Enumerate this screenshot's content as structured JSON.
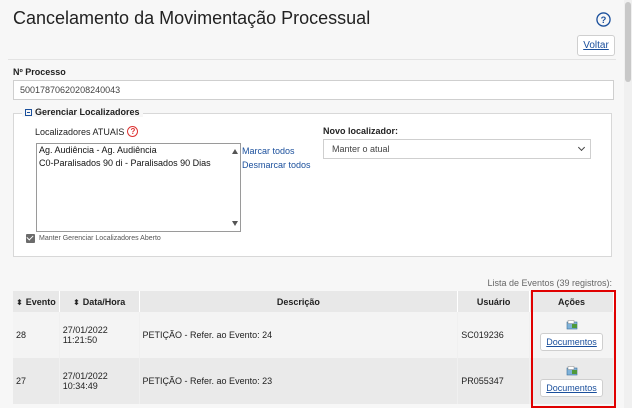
{
  "page": {
    "title": "Cancelamento da Movimentação Processual",
    "voltar_label": "Voltar"
  },
  "processo": {
    "label": "Nº Processo",
    "value": "50017870620208240043"
  },
  "localizadores": {
    "legend": "Gerenciar Localizadores",
    "atuais_label": "Localizadores ATUAIS",
    "options": [
      "Ag. Audiência - Ag. Audiência",
      "C0-Paralisados 90 di - Paralisados 90 Dias"
    ],
    "marcar_todos": "Marcar todos",
    "desmarcar_todos": "Desmarcar todos",
    "novo_label": "Novo localizador:",
    "novo_selected": "Manter o atual",
    "manter_aberto_label": "Manter Gerenciar Localizadores Aberto",
    "manter_aberto_checked": true
  },
  "eventos": {
    "count_label": "Lista de Eventos (39 registros):",
    "columns": [
      "Evento",
      "Data/Hora",
      "Descrição",
      "Usuário",
      "Ações"
    ],
    "rows": [
      {
        "evento": "28",
        "data": "27/01/2022",
        "hora": "11:21:50",
        "descricao": "PETIÇÃO - Refer. ao Evento: 24",
        "usuario": "SC019236",
        "acao": "Documentos"
      },
      {
        "evento": "27",
        "data": "27/01/2022",
        "hora": "10:34:49",
        "descricao": "PETIÇÃO - Refer. ao Evento: 23",
        "usuario": "PR055347",
        "acao": "Documentos"
      }
    ]
  },
  "colors": {
    "link": "#1a4f9c",
    "highlight": "#e00000",
    "help": "#1a4f9c"
  },
  "icons": [
    "help-icon",
    "question-icon",
    "minus-icon",
    "sort-icon",
    "document-icon",
    "chevron-down-icon"
  ]
}
